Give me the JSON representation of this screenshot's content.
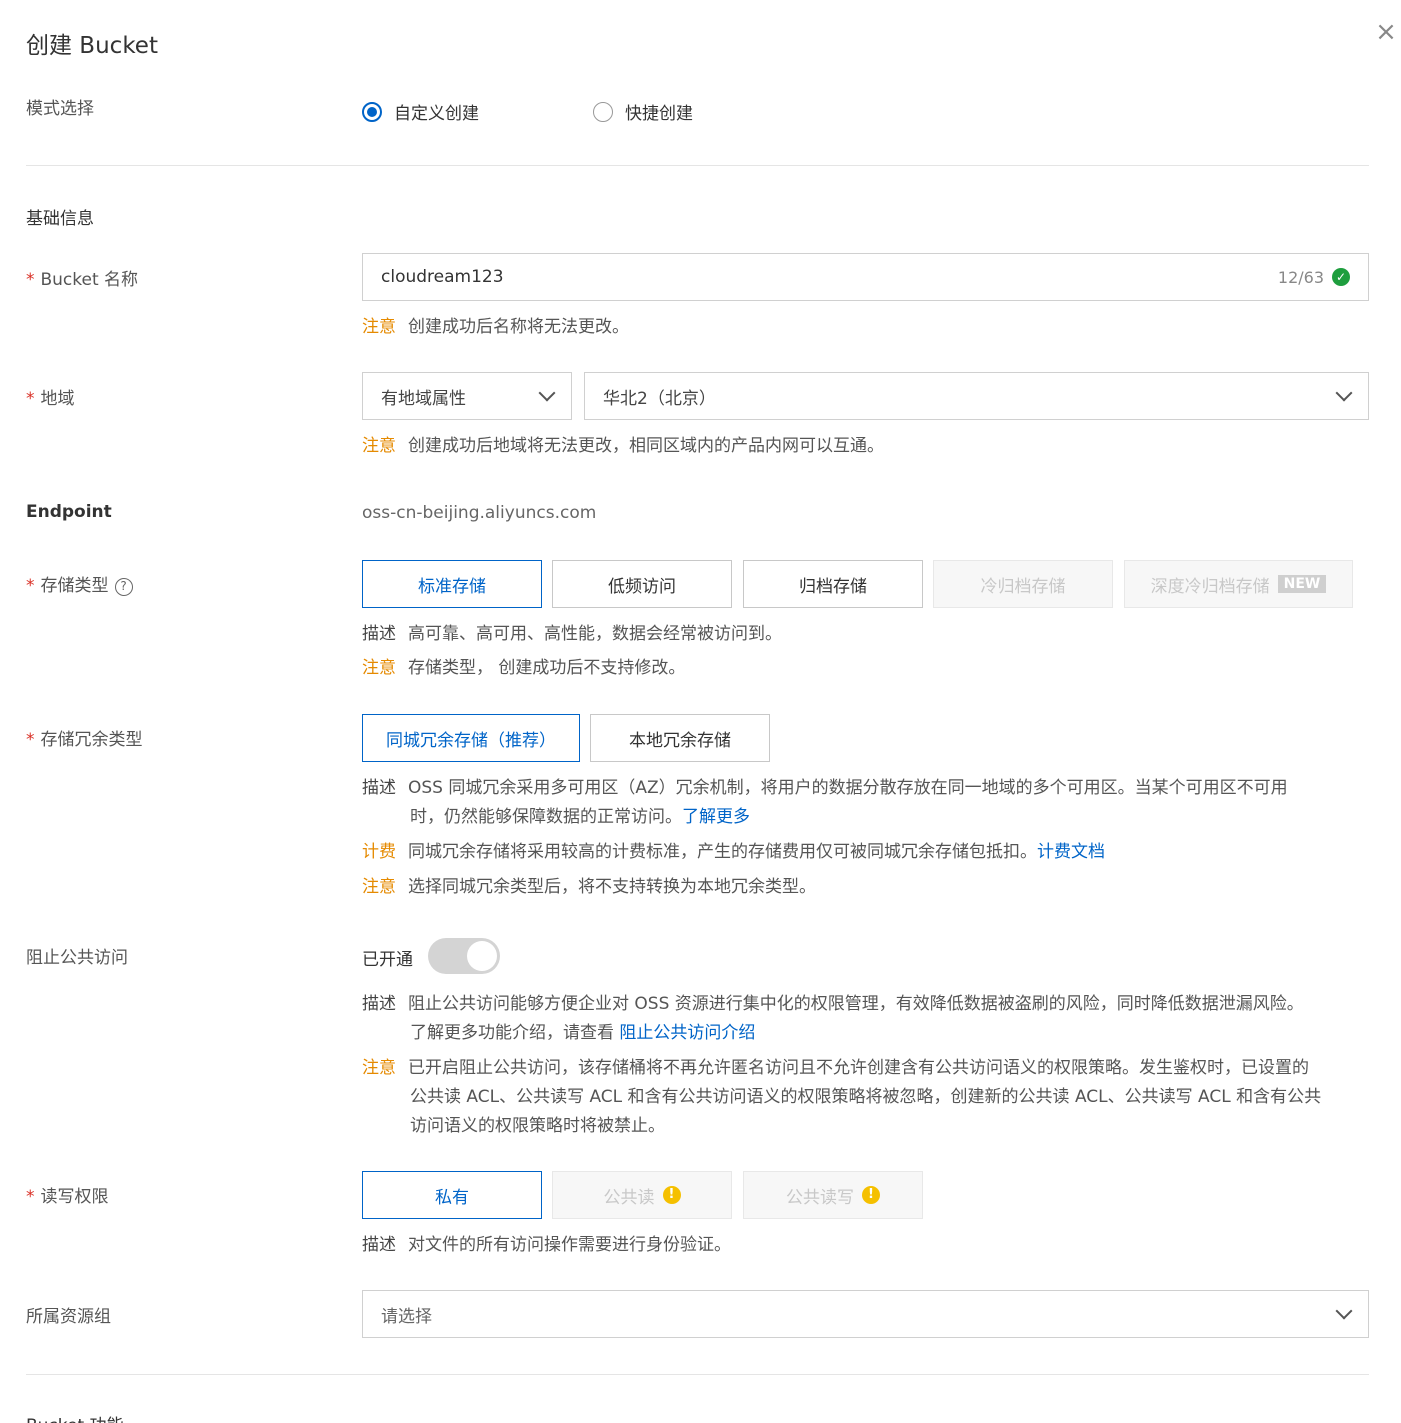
{
  "dialog": {
    "title": "创建 Bucket",
    "close": "×"
  },
  "mode": {
    "label": "模式选择",
    "options": [
      "自定义创建",
      "快捷创建"
    ],
    "selected": "自定义创建"
  },
  "basic": {
    "section_title": "基础信息"
  },
  "bucket_name": {
    "required_mark": "*",
    "label": "Bucket 名称",
    "value": "cloudream123",
    "count": "12/63",
    "valid_icon": "check-circle-icon",
    "note_tag": "注意",
    "note_text": "创建成功后名称将无法更改。"
  },
  "region": {
    "required_mark": "*",
    "label": "地域",
    "attr_value": "有地域属性",
    "region_value": "华北2（北京）",
    "note_tag": "注意",
    "note_text": "创建成功后地域将无法更改，相同区域内的产品内网可以互通。"
  },
  "endpoint": {
    "label": "Endpoint",
    "value": "oss-cn-beijing.aliyuncs.com"
  },
  "storage_type": {
    "required_mark": "*",
    "label": "存储类型",
    "help": "?",
    "options": [
      "标准存储",
      "低频访问",
      "归档存储",
      "冷归档存储",
      "深度冷归档存储"
    ],
    "new_badge": "NEW",
    "desc_tag": "描述",
    "desc_text": "高可靠、高可用、高性能，数据会经常被访问到。",
    "note_tag": "注意",
    "note_text": "存储类型， 创建成功后不支持修改。"
  },
  "redundancy": {
    "required_mark": "*",
    "label": "存储冗余类型",
    "options": [
      "同城冗余存储（推荐）",
      "本地冗余存储"
    ],
    "desc_tag": "描述",
    "desc_line1": "OSS 同城冗余采用多可用区（AZ）冗余机制，将用户的数据分散存放在同一地域的多个可用区。当某个可用区不可用",
    "desc_line2": "时，仍然能够保障数据的正常访问。",
    "desc_link": "了解更多",
    "billing_tag": "计费",
    "billing_text": "同城冗余存储将采用较高的计费标准，产生的存储费用仅可被同城冗余存储包抵扣。",
    "billing_link": "计费文档",
    "note_tag": "注意",
    "note_text": "选择同城冗余类型后，将不支持转换为本地冗余类型。"
  },
  "block_public": {
    "label": "阻止公共访问",
    "status": "已开通",
    "desc_tag": "描述",
    "desc_line1": "阻止公共访问能够方便企业对 OSS 资源进行集中化的权限管理，有效降低数据被盗刷的风险，同时降低数据泄漏风险。",
    "desc_line2": "了解更多功能介绍，请查看 ",
    "desc_link": "阻止公共访问介绍",
    "note_tag": "注意",
    "note_line1": "已开启阻止公共访问，该存储桶将不再允许匿名访问且不允许创建含有公共访问语义的权限策略。发生鉴权时，已设置的",
    "note_line2": "公共读 ACL、公共读写 ACL 和含有公共访问语义的权限策略将被忽略，创建新的公共读 ACL、公共读写 ACL 和含有公共",
    "note_line3": "访问语义的权限策略时将被禁止。"
  },
  "acl": {
    "required_mark": "*",
    "label": "读写权限",
    "options": [
      "私有",
      "公共读",
      "公共读写"
    ],
    "warn": "!",
    "desc_tag": "描述",
    "desc_text": "对文件的所有访问操作需要进行身份验证。"
  },
  "resource_group": {
    "label": "所属资源组",
    "placeholder": "请选择"
  },
  "features": {
    "section_title": "Bucket 功能"
  }
}
